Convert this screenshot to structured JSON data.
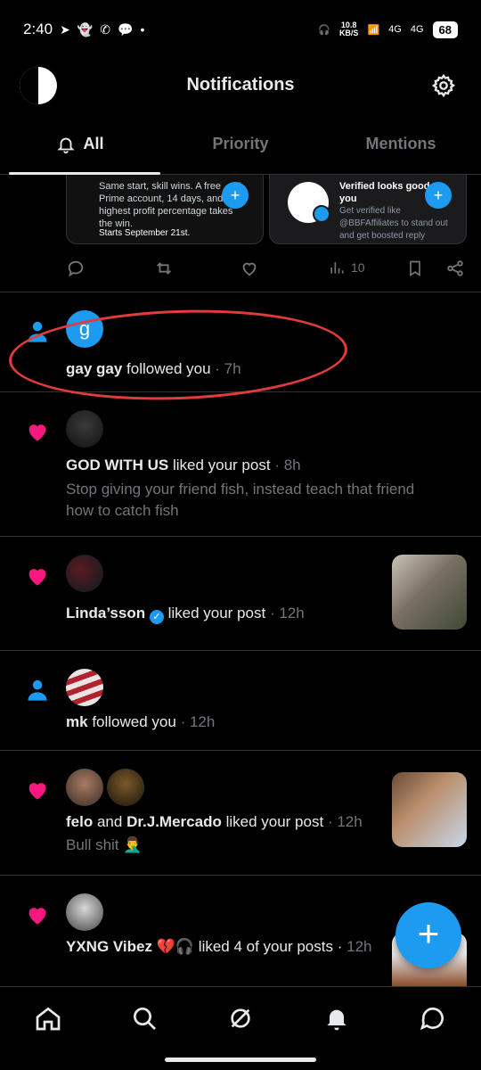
{
  "status_bar": {
    "time": "2:40",
    "left_icons": [
      "telegram-icon",
      "snapchat-icon",
      "whatsapp-icon",
      "chat-icon"
    ],
    "net_speed_value": "10.8",
    "net_speed_unit": "KB/S",
    "signal1": "4G",
    "signal2": "4G",
    "battery": "68"
  },
  "header": {
    "title": "Notifications"
  },
  "tabs": [
    {
      "label": "All",
      "active": true
    },
    {
      "label": "Priority",
      "active": false
    },
    {
      "label": "Mentions",
      "active": false
    }
  ],
  "embedded_cards": {
    "card1_text": "Same start, skill wins. A free ... K Prime account, 14 days, and highest profit percentage takes the win.",
    "card1_footer": "Starts September 21st.",
    "card2_title": "Verified looks good on you",
    "card2_text": "Get verified like @BBFAffiliates to stand out and get boosted reply reach."
  },
  "post_actions": {
    "views": "10"
  },
  "notifications": [
    {
      "type": "follow",
      "avatar_letter": "g",
      "user": "gay gay",
      "action": "followed you",
      "time": "· 7h"
    },
    {
      "type": "like",
      "user": "GOD WITH US",
      "action": "liked your post",
      "time": "· 8h",
      "snippet": "Stop giving your friend fish, instead teach that friend how to catch fish"
    },
    {
      "type": "like",
      "user": "Linda’sson",
      "verified": true,
      "action": "liked your post",
      "time": "· 12h"
    },
    {
      "type": "follow",
      "user": "mk",
      "action": "followed you",
      "time": "· 12h"
    },
    {
      "type": "like",
      "user": "felo",
      "joiner": "and",
      "user2": "Dr.J.Mercado",
      "action": "liked your post",
      "time": "· 12h",
      "snippet": "Bull shit 🤦‍♂️"
    },
    {
      "type": "like",
      "user": "YXNG Vibez 💔🎧",
      "action": "liked 4 of your posts ·",
      "time": "12h"
    }
  ],
  "colors": {
    "accent": "#1d9bf0",
    "like": "#f91880",
    "annotation": "#e23b3b"
  }
}
